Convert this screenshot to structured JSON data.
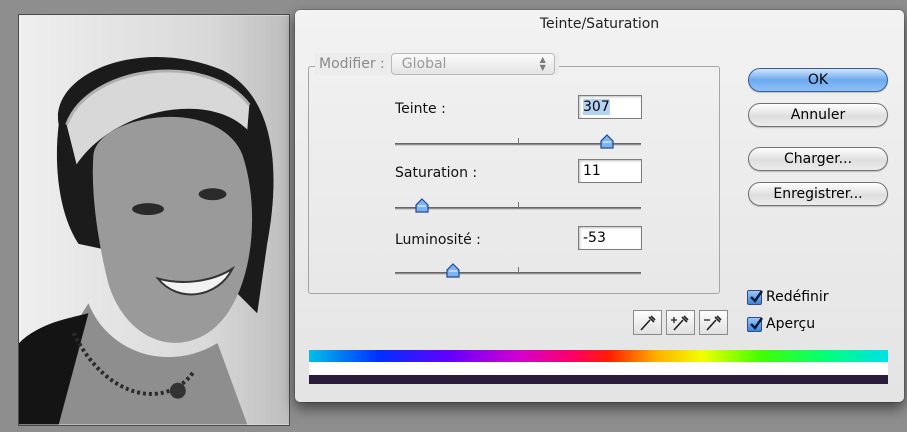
{
  "dialog": {
    "title": "Teinte/Saturation",
    "modifier": {
      "label": "Modifier :",
      "value": "Global"
    },
    "fields": [
      {
        "label": "Teinte :",
        "value": "307",
        "slider_fraction": 0.862
      },
      {
        "label": "Saturation :",
        "value": "11",
        "slider_fraction": 0.11
      },
      {
        "label": "Luminosité :",
        "value": "-53",
        "slider_fraction": 0.235
      }
    ],
    "buttons": {
      "ok": "OK",
      "cancel": "Annuler",
      "load": "Charger...",
      "save": "Enregistrer..."
    },
    "checkboxes": {
      "colorize": {
        "label": "Redéfinir",
        "checked": true
      },
      "preview": {
        "label": "Aperçu",
        "checked": true
      }
    },
    "colors": {
      "accent": "#6eaaf0",
      "spectrum_bottom": "#2a1c3a"
    }
  }
}
